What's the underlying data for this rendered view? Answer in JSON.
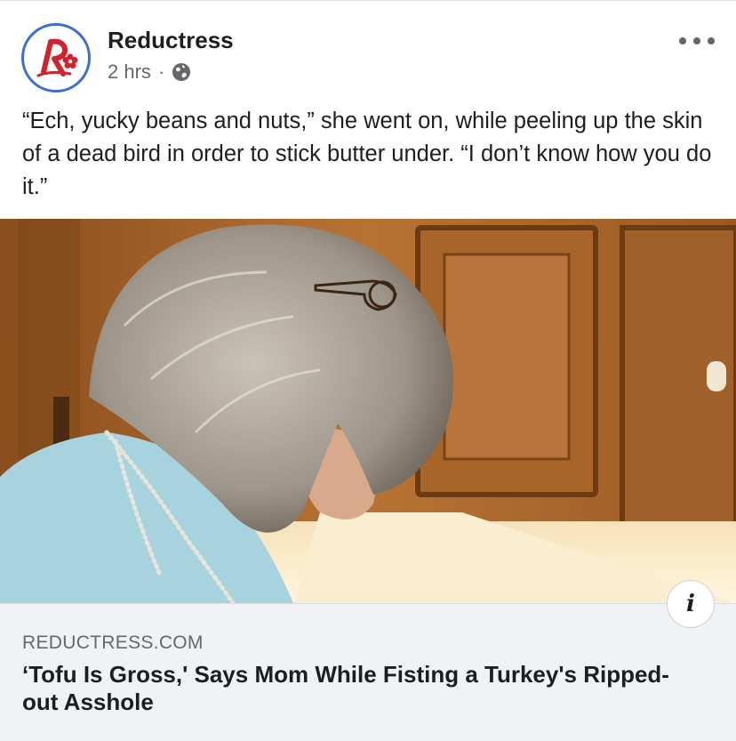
{
  "post": {
    "page_name": "Reductress",
    "timestamp": "2 hrs",
    "separator": "·",
    "privacy_icon": "globe-icon",
    "more_icon": "more-options-icon",
    "text": "“Ech, yucky beans and nuts,” she went on, while peeling up the skin of a dead bird in order to stick butter under. “I don’t know how you do it.”"
  },
  "link_preview": {
    "info_icon_label": "i",
    "domain": "REDUCTRESS.COM",
    "headline": "‘Tofu Is Gross,' Says Mom While Fisting a Turkey's Ripped-out Asshole"
  },
  "colors": {
    "brand_red": "#d0232c",
    "avatar_ring": "#3a6fd1",
    "secondary_text": "#65676b",
    "link_box_bg": "#f0f2f5"
  }
}
